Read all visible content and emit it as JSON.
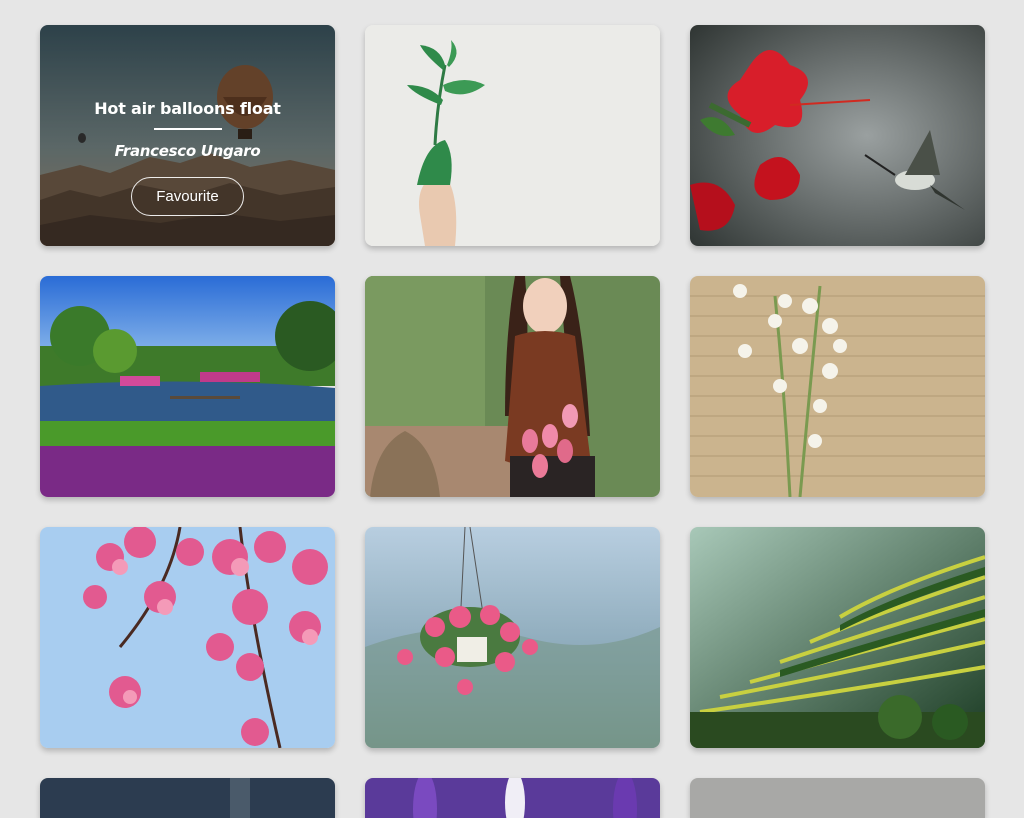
{
  "gallery": {
    "featured": {
      "title": "Hot air balloons float",
      "author": "Francesco Ungaro",
      "button_label": "Favourite"
    },
    "cards": [
      {
        "subject": "hot-air-balloons"
      },
      {
        "subject": "hand-holding-plant"
      },
      {
        "subject": "hibiscus-hummingbird"
      },
      {
        "subject": "garden-pond"
      },
      {
        "subject": "woman-with-tulips"
      },
      {
        "subject": "lily-of-the-valley"
      },
      {
        "subject": "cherry-blossoms"
      },
      {
        "subject": "hanging-flower-pot"
      },
      {
        "subject": "rice-terraces"
      }
    ]
  }
}
